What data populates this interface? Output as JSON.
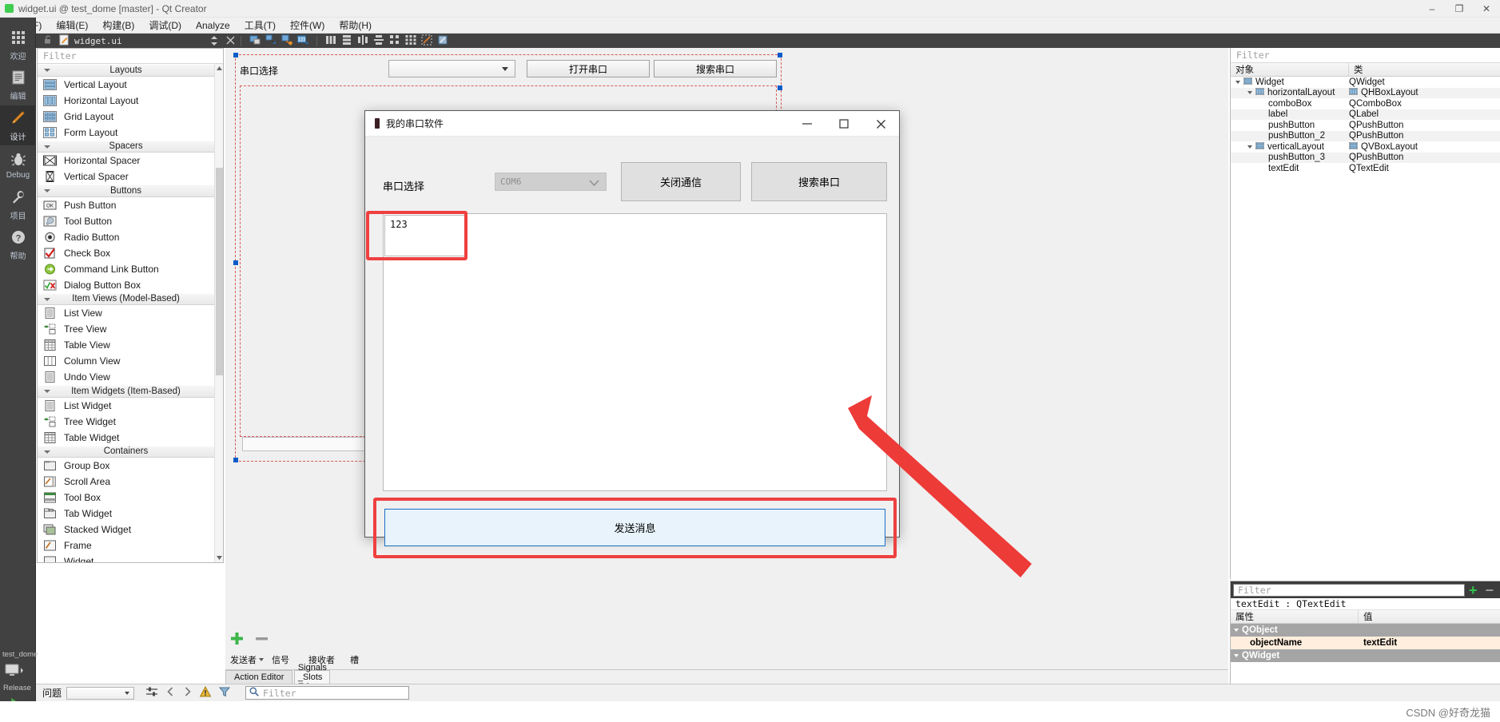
{
  "window": {
    "title": "widget.ui @ test_dome [master] - Qt Creator",
    "logo_icon": "qt-logo-icon",
    "controls": [
      {
        "name": "minimize-button",
        "glyph": "–"
      },
      {
        "name": "maximize-button",
        "glyph": "❐"
      },
      {
        "name": "close-button",
        "glyph": "✕"
      }
    ]
  },
  "menubar": [
    {
      "label": "文件(F)"
    },
    {
      "label": "编辑(E)"
    },
    {
      "label": "构建(B)"
    },
    {
      "label": "调试(D)"
    },
    {
      "label": "Analyze"
    },
    {
      "label": "工具(T)"
    },
    {
      "label": "控件(W)"
    },
    {
      "label": "帮助(H)"
    }
  ],
  "activitybar": {
    "items": [
      {
        "label": "欢迎",
        "icon": "grid-icon",
        "selected": false
      },
      {
        "label": "编辑",
        "icon": "document-lines-icon",
        "selected": false
      },
      {
        "label": "设计",
        "icon": "pencil-icon",
        "selected": true
      },
      {
        "label": "Debug",
        "icon": "bug-icon",
        "selected": false
      },
      {
        "label": "项目",
        "icon": "wrench-icon",
        "selected": false
      },
      {
        "label": "帮助",
        "icon": "question-circle-icon",
        "selected": false
      }
    ],
    "project_name": "test_dome",
    "build_config": "Release",
    "run_icon": "run-triangle-icon",
    "kit_icon": "desktop-kit-icon"
  },
  "editor_toolstrip": {
    "filename": "widget.ui",
    "lock_icon": "unlocked-icon",
    "file_icon": "ui-file-icon",
    "close_icon": "close-icon",
    "split_icon": "updown-arrows-icon",
    "tool_icons": [
      "edit-widgets-icon",
      "edit-signals-slots-icon",
      "edit-buddies-icon",
      "edit-tab-order-icon",
      "layout-horizontal-icon",
      "layout-vertical-icon",
      "layout-splitter-h-icon",
      "layout-splitter-v-icon",
      "layout-form-icon",
      "layout-grid-icon",
      "break-layout-icon",
      "adjust-size-icon"
    ]
  },
  "widgetbox": {
    "filter_placeholder": "Filter",
    "groups": [
      {
        "label": "Layouts",
        "items": [
          {
            "label": "Vertical Layout",
            "icon": "layout-vertical-icon"
          },
          {
            "label": "Horizontal Layout",
            "icon": "layout-horizontal-icon"
          },
          {
            "label": "Grid Layout",
            "icon": "layout-grid-icon"
          },
          {
            "label": "Form Layout",
            "icon": "layout-form-icon"
          }
        ]
      },
      {
        "label": "Spacers",
        "items": [
          {
            "label": "Horizontal Spacer",
            "icon": "spacer-horizontal-icon"
          },
          {
            "label": "Vertical Spacer",
            "icon": "spacer-vertical-icon"
          }
        ]
      },
      {
        "label": "Buttons",
        "items": [
          {
            "label": "Push Button",
            "icon": "push-button-icon"
          },
          {
            "label": "Tool Button",
            "icon": "tool-button-icon"
          },
          {
            "label": "Radio Button",
            "icon": "radio-button-icon"
          },
          {
            "label": "Check Box",
            "icon": "check-box-icon"
          },
          {
            "label": "Command Link Button",
            "icon": "command-link-icon"
          },
          {
            "label": "Dialog Button Box",
            "icon": "dialog-button-box-icon"
          }
        ]
      },
      {
        "label": "Item Views (Model-Based)",
        "items": [
          {
            "label": "List View",
            "icon": "list-view-icon"
          },
          {
            "label": "Tree View",
            "icon": "tree-view-icon"
          },
          {
            "label": "Table View",
            "icon": "table-view-icon"
          },
          {
            "label": "Column View",
            "icon": "column-view-icon"
          },
          {
            "label": "Undo View",
            "icon": "undo-view-icon"
          }
        ]
      },
      {
        "label": "Item Widgets (Item-Based)",
        "items": [
          {
            "label": "List Widget",
            "icon": "list-widget-icon"
          },
          {
            "label": "Tree Widget",
            "icon": "tree-widget-icon"
          },
          {
            "label": "Table Widget",
            "icon": "table-widget-icon"
          }
        ]
      },
      {
        "label": "Containers",
        "items": [
          {
            "label": "Group Box",
            "icon": "group-box-icon"
          },
          {
            "label": "Scroll Area",
            "icon": "scroll-area-icon"
          },
          {
            "label": "Tool Box",
            "icon": "tool-box-icon"
          },
          {
            "label": "Tab Widget",
            "icon": "tab-widget-icon"
          },
          {
            "label": "Stacked Widget",
            "icon": "stacked-widget-icon"
          },
          {
            "label": "Frame",
            "icon": "frame-icon"
          },
          {
            "label": "Widget",
            "icon": "widget-icon"
          }
        ]
      }
    ]
  },
  "form_editor": {
    "label": "串口选择",
    "combo_value": "",
    "buttons": [
      {
        "label": "打开串口"
      },
      {
        "label": "搜索串口"
      }
    ]
  },
  "signal_slot_editor": {
    "add_icon": "plus-icon",
    "remove_icon": "minus-icon",
    "columns": [
      "发送者",
      "信号",
      "接收者",
      "槽"
    ],
    "tabs": [
      {
        "label": "Action Editor",
        "active": false
      },
      {
        "label": "Signals _Slots Ed···",
        "active": true
      }
    ]
  },
  "object_inspector": {
    "filter_placeholder": "Filter",
    "columns": [
      "对象",
      "类"
    ],
    "rows": [
      {
        "object": "Widget",
        "class": "QWidget",
        "indent": 0,
        "expander": true,
        "icon": "widget-icon",
        "class_icon": ""
      },
      {
        "object": "horizontalLayout",
        "class": "QHBoxLayout",
        "indent": 1,
        "expander": true,
        "icon": "layout-horizontal-icon",
        "class_icon": "layout-horizontal-icon"
      },
      {
        "object": "comboBox",
        "class": "QComboBox",
        "indent": 2,
        "expander": false,
        "icon": "",
        "class_icon": ""
      },
      {
        "object": "label",
        "class": "QLabel",
        "indent": 2,
        "expander": false,
        "icon": "",
        "class_icon": ""
      },
      {
        "object": "pushButton",
        "class": "QPushButton",
        "indent": 2,
        "expander": false,
        "icon": "",
        "class_icon": ""
      },
      {
        "object": "pushButton_2",
        "class": "QPushButton",
        "indent": 2,
        "expander": false,
        "icon": "",
        "class_icon": ""
      },
      {
        "object": "verticalLayout",
        "class": "QVBoxLayout",
        "indent": 1,
        "expander": true,
        "icon": "layout-vertical-icon",
        "class_icon": "layout-vertical-icon"
      },
      {
        "object": "pushButton_3",
        "class": "QPushButton",
        "indent": 2,
        "expander": false,
        "icon": "",
        "class_icon": ""
      },
      {
        "object": "textEdit",
        "class": "QTextEdit",
        "indent": 2,
        "expander": false,
        "icon": "",
        "class_icon": ""
      }
    ]
  },
  "property_editor": {
    "filter_placeholder": "Filter",
    "selection": "textEdit : QTextEdit",
    "columns": [
      "属性",
      "值"
    ],
    "rows": [
      {
        "name": "QObject",
        "value": "",
        "group": true
      },
      {
        "name": "objectName",
        "value": "textEdit",
        "group": false,
        "highlight": true
      },
      {
        "name": "QWidget",
        "value": "",
        "group": true
      }
    ]
  },
  "bottom_bar": {
    "label": "问题",
    "filter_placeholder": "Filter",
    "search_icon": "search-icon",
    "warning_icon": "warning-icon",
    "funnel_icon": "filter-funnel-icon",
    "prev_icon": "chevron-left-icon",
    "next_icon": "chevron-right-icon",
    "settings_icon": "sliders-icon"
  },
  "statusbar": {
    "credit": "CSDN @好奇龙猫"
  },
  "dialog": {
    "title": "我的串口软件",
    "icon": "app-icon",
    "controls": [
      {
        "name": "dialog-minimize-button",
        "glyph": "–"
      },
      {
        "name": "dialog-maximize-button",
        "glyph": "☐"
      },
      {
        "name": "dialog-close-button",
        "glyph": "✕"
      }
    ],
    "port_label": "串口选择",
    "port_value": "COM6",
    "port_disabled": true,
    "close_comm_button": "关闭通信",
    "search_port_button": "搜索串口",
    "send_input_value": "123",
    "receive_area_value": "",
    "send_button": "发送消息"
  },
  "annotation": {
    "arrow_color": "#ed3b38",
    "highlight_color": "#ef4040"
  }
}
